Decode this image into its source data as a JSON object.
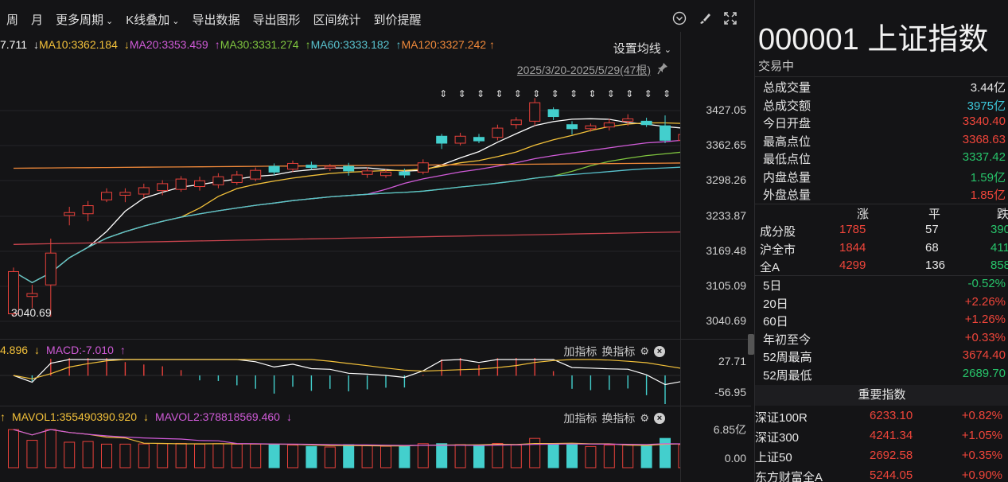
{
  "toolbar": {
    "items": [
      "周",
      "月",
      "更多周期",
      "K线叠加",
      "导出数据",
      "导出图形",
      "区间统计",
      "到价提醒"
    ],
    "dropdown_flags": [
      false,
      false,
      true,
      true,
      false,
      false,
      false,
      false
    ],
    "icons": [
      "chevron-circle-icon",
      "brush-icon",
      "expand-icon"
    ]
  },
  "ma": {
    "partial": "7.711",
    "ma10": "MA10:3362.184",
    "ma20": "MA20:3353.459",
    "ma30": "MA30:3331.274",
    "ma60": "MA60:3333.182",
    "ma120": "MA120:3327.242",
    "arrow_down": "↓",
    "arrow_up": "↑",
    "settings_label": "设置均线",
    "colors": {
      "ma5": "#ffffff",
      "ma10": "#f3c13a",
      "ma20": "#d05bd8",
      "ma30": "#7fc53f",
      "ma60": "#59c3cf",
      "ma120": "#f0893a"
    }
  },
  "range_label": "2025/3/20-2025/5/29(47根)",
  "price_axis": [
    "3427.05",
    "3362.65",
    "3298.26",
    "3233.87",
    "3169.48",
    "3105.09",
    "3040.69"
  ],
  "low_label": "3040.69",
  "macd": {
    "partial": "4.896",
    "label": "MACD:-7.010",
    "axis": [
      "27.71",
      "-56.95"
    ],
    "add": "加指标",
    "switch": "换指标"
  },
  "vol": {
    "mavol1": "MAVOL1:355490390.920",
    "mavol2": "MAVOL2:378818569.460",
    "axis": [
      "6.85亿",
      "0.00"
    ],
    "add": "加指标",
    "switch": "换指标"
  },
  "chart_data": {
    "type": "candlestick",
    "y_range": [
      3010,
      3450
    ],
    "candles": [
      [
        3045,
        3118,
        3040,
        3125
      ],
      [
        3075,
        3080,
        3055,
        3095
      ],
      [
        3095,
        3150,
        3040,
        3175
      ],
      [
        3215,
        3220,
        3198,
        3230
      ],
      [
        3218,
        3232,
        3205,
        3240
      ],
      [
        3242,
        3255,
        3238,
        3262
      ],
      [
        3250,
        3255,
        3238,
        3262
      ],
      [
        3252,
        3263,
        3245,
        3270
      ],
      [
        3258,
        3270,
        3250,
        3276
      ],
      [
        3260,
        3278,
        3256,
        3283
      ],
      [
        3265,
        3275,
        3258,
        3282
      ],
      [
        3268,
        3282,
        3262,
        3288
      ],
      [
        3272,
        3285,
        3268,
        3292
      ],
      [
        3278,
        3293,
        3274,
        3298
      ],
      [
        3300,
        3290,
        3284,
        3305
      ],
      [
        3295,
        3305,
        3290,
        3310
      ],
      [
        3302,
        3298,
        3294,
        3308
      ],
      [
        3297,
        3300,
        3292,
        3304
      ],
      [
        3300,
        3292,
        3284,
        3306
      ],
      [
        3286,
        3292,
        3280,
        3298
      ],
      [
        3284,
        3290,
        3280,
        3295
      ],
      [
        3290,
        3285,
        3280,
        3296
      ],
      [
        3290,
        3306,
        3286,
        3312
      ],
      [
        3352,
        3340,
        3330,
        3356
      ],
      [
        3340,
        3352,
        3336,
        3358
      ],
      [
        3350,
        3344,
        3340,
        3356
      ],
      [
        3350,
        3366,
        3345,
        3372
      ],
      [
        3372,
        3380,
        3365,
        3385
      ],
      [
        3378,
        3410,
        3370,
        3418
      ],
      [
        3398,
        3386,
        3380,
        3402
      ],
      [
        3372,
        3365,
        3355,
        3378
      ],
      [
        3365,
        3370,
        3360,
        3374
      ],
      [
        3368,
        3375,
        3362,
        3382
      ],
      [
        3378,
        3382,
        3370,
        3390
      ],
      [
        3378,
        3372,
        3368,
        3384
      ],
      [
        3370,
        3345,
        3340,
        3388
      ],
      [
        3345,
        3355,
        3340,
        3362
      ],
      [
        3355,
        3350,
        3345,
        3365
      ],
      [
        3348,
        3344,
        3338,
        3356
      ],
      [
        3344,
        3358,
        3340,
        3368
      ]
    ],
    "limit_markers_count": 14,
    "volume_ylim": [
      0,
      6.85
    ]
  },
  "quote": {
    "title": "000001 上证指数",
    "status": "交易中",
    "rows": [
      {
        "k": "总成交量",
        "v": "3.44亿",
        "c": "white"
      },
      {
        "k": "总成交额",
        "v": "3975亿",
        "c": "cyan"
      },
      {
        "k": "今日开盘",
        "v": "3340.40",
        "c": "red"
      },
      {
        "k": "最高点位",
        "v": "3368.63",
        "c": "red"
      },
      {
        "k": "最低点位",
        "v": "3337.42",
        "c": "green"
      },
      {
        "k": "内盘总量",
        "v": "1.59亿",
        "c": "green"
      },
      {
        "k": "外盘总量",
        "v": "1.85亿",
        "c": "red"
      }
    ]
  },
  "breadth": {
    "headers": [
      "涨",
      "平",
      "跌"
    ],
    "rows": [
      {
        "k": "成分股",
        "up": "1785",
        "flat": "57",
        "down": "390"
      },
      {
        "k": "沪全市",
        "up": "1844",
        "flat": "68",
        "down": "411"
      },
      {
        "k": "全A",
        "up": "4299",
        "flat": "136",
        "down": "858"
      }
    ]
  },
  "perf": [
    {
      "k": "5日",
      "v": "-0.52%",
      "c": "green"
    },
    {
      "k": "20日",
      "v": "+2.26%",
      "c": "red"
    },
    {
      "k": "60日",
      "v": "+1.26%",
      "c": "red"
    },
    {
      "k": "年初至今",
      "v": "+0.33%",
      "c": "red"
    },
    {
      "k": "52周最高",
      "v": "3674.40",
      "c": "red"
    },
    {
      "k": "52周最低",
      "v": "2689.70",
      "c": "green"
    }
  ],
  "indices_title": "重要指数",
  "indices": [
    {
      "name": "深证100R",
      "price": "6233.10",
      "chg": "+0.82%"
    },
    {
      "name": "深证300",
      "price": "4241.34",
      "chg": "+1.05%"
    },
    {
      "name": "上证50",
      "price": "2692.58",
      "chg": "+0.35%"
    },
    {
      "name": "东方财富全A",
      "price": "5244.05",
      "chg": "+0.90%"
    }
  ]
}
